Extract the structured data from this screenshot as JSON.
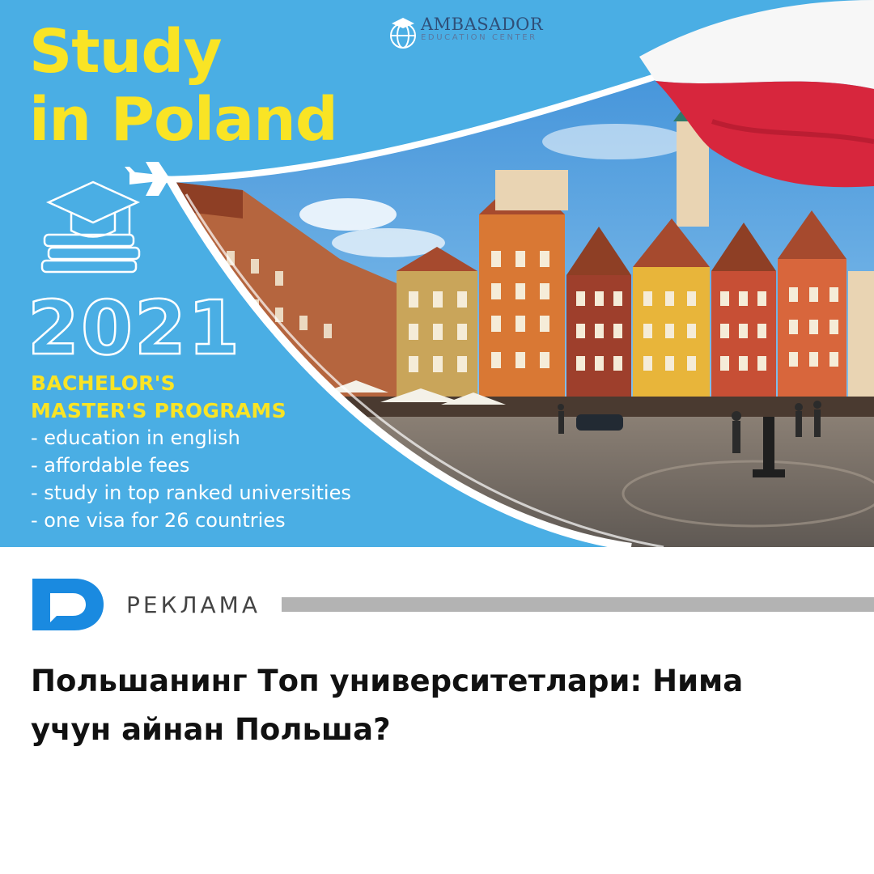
{
  "banner": {
    "headline_line1": "Study",
    "headline_line2": "in Poland",
    "year": "2021",
    "programs_line1": "BACHELOR'S",
    "programs_line2": "MASTER'S PROGRAMS",
    "features": [
      "- education in english",
      "- affordable fees",
      "- study in top ranked universities",
      "- one visa for 26 countries"
    ],
    "logo": {
      "name": "AMBASADOR",
      "subtitle": "EDUCATION CENTER",
      "icon": "globe-icon"
    },
    "colors": {
      "background": "#4aaee4",
      "headline": "#f9e425",
      "flag_white": "#ffffff",
      "flag_red": "#d7263d"
    }
  },
  "ad": {
    "label": "РЕКЛАМА",
    "logo_icon": "d-speech-bubble-icon",
    "logo_color": "#1a8ae0"
  },
  "article": {
    "title_line1": "Польшанинг Топ университетлари: Нима",
    "title_line2": "учун айнан Польша?"
  }
}
